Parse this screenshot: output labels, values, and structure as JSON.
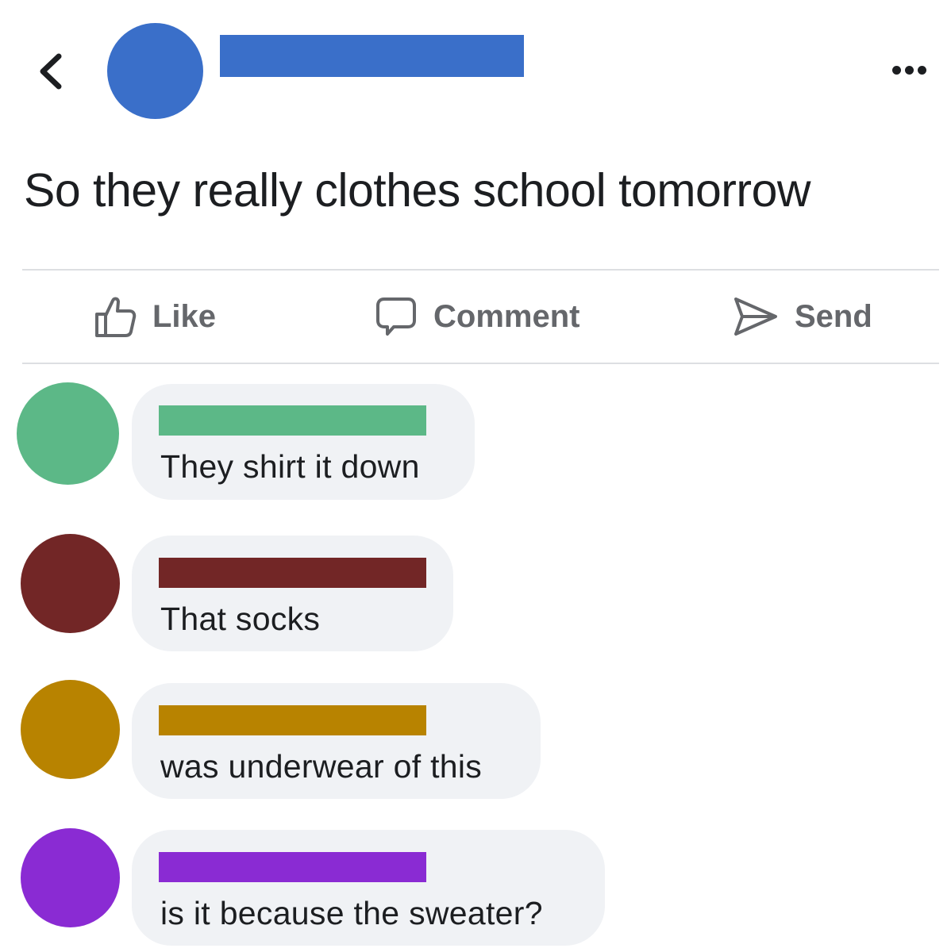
{
  "header": {
    "back_icon": "chevron-left-icon",
    "more_icon": "more-horizontal-icon",
    "poster": {
      "avatar_color": "#3a6fc9",
      "name_redaction_color": "#3a6fc9"
    }
  },
  "post": {
    "text": "So they really clothes school tomorrow"
  },
  "actions": {
    "like_label": "Like",
    "comment_label": "Comment",
    "send_label": "Send",
    "icon_color": "#65676b"
  },
  "comments": [
    {
      "text": "They shirt it down",
      "avatar_color": "#5cb887",
      "name_redaction_color": "#5cb887"
    },
    {
      "text": "That socks",
      "avatar_color": "#722626",
      "name_redaction_color": "#722626"
    },
    {
      "text": "was underwear of this",
      "avatar_color": "#b88300",
      "name_redaction_color": "#b88300"
    },
    {
      "text": "is it because the sweater?",
      "avatar_color": "#8a2bd3",
      "name_redaction_color": "#8a2bd3"
    }
  ]
}
